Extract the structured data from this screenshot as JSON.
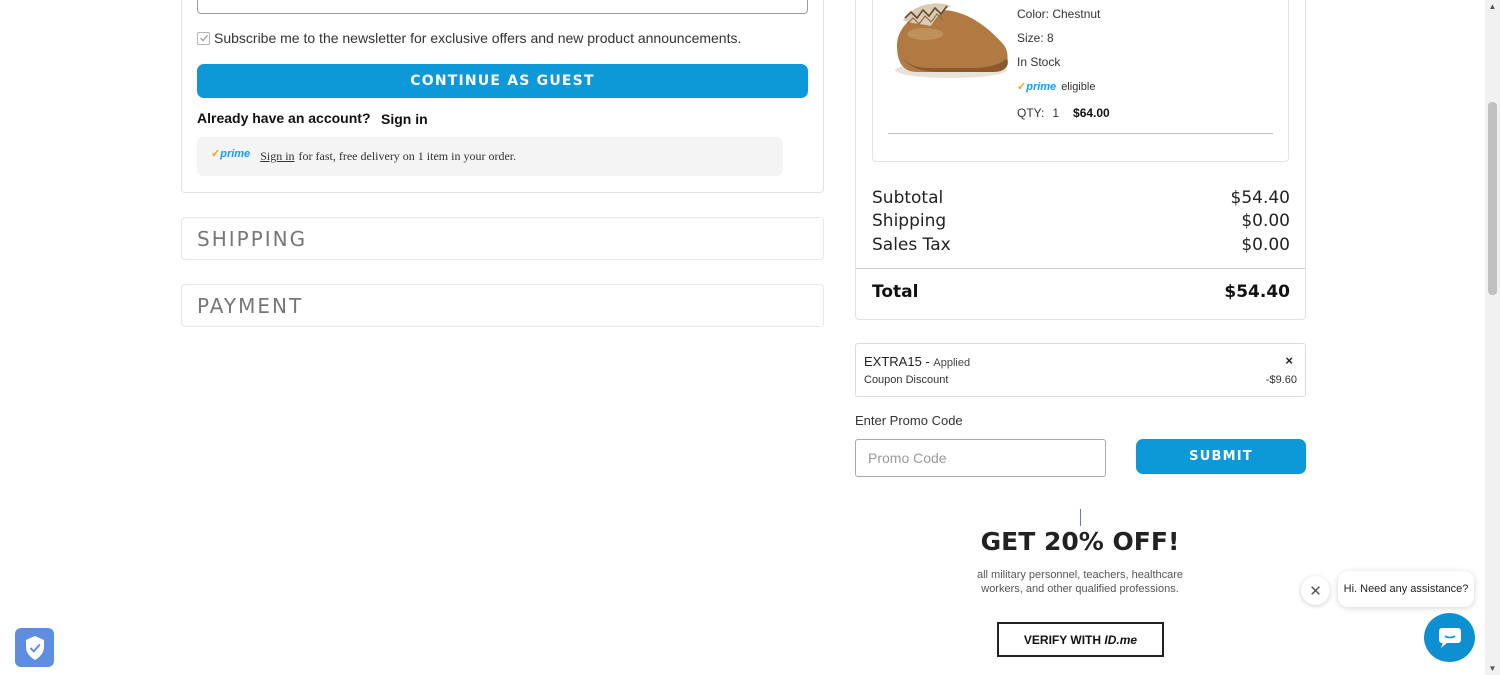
{
  "checkout": {
    "subscribe_label": "Subscribe me to the newsletter for exclusive offers and new product announcements.",
    "guest_button": "CONTINUE AS GUEST",
    "account_question": "Already have an account?",
    "sign_in": "Sign in",
    "prime": {
      "logo": "prime",
      "sign_in_link": "Sign in",
      "message": "for fast, free delivery on 1 item in your order."
    },
    "sections": [
      "SHIPPING",
      "PAYMENT"
    ]
  },
  "cart_item": {
    "color": "Color: Chestnut",
    "size": "Size: 8",
    "stock": "In Stock",
    "prime_logo": "prime",
    "prime_eligible": "eligible",
    "qty_label": "QTY:",
    "qty_value": "1",
    "price": "$64.00"
  },
  "summary": {
    "subtotal_label": "Subtotal",
    "subtotal_value": "$54.40",
    "shipping_label": "Shipping",
    "shipping_value": "$0.00",
    "tax_label": "Sales Tax",
    "tax_value": "$0.00",
    "total_label": "Total",
    "total_value": "$54.40"
  },
  "coupon": {
    "code": "EXTRA15 -",
    "status": "Applied",
    "remove": "×",
    "discount_label": "Coupon Discount",
    "discount_value": "-$9.60"
  },
  "promo": {
    "label": "Enter Promo Code",
    "placeholder": "Promo Code",
    "value": "",
    "submit": "SUBMIT"
  },
  "military": {
    "headline": "GET 20% OFF!",
    "description": "all military personnel, teachers, healthcare workers, and other qualified professions.",
    "verify_prefix": "VERIFY WITH ",
    "verify_brand": "ID.me"
  },
  "chat": {
    "greeting": "Hi. Need any assistance?",
    "close": "✕"
  },
  "colors": {
    "accent": "#0d98d8",
    "prime_blue": "#1a98ff",
    "prime_orange": "#f0a30a",
    "chat_blue": "#0c90d2",
    "shield_blue": "#5d8ee0"
  }
}
